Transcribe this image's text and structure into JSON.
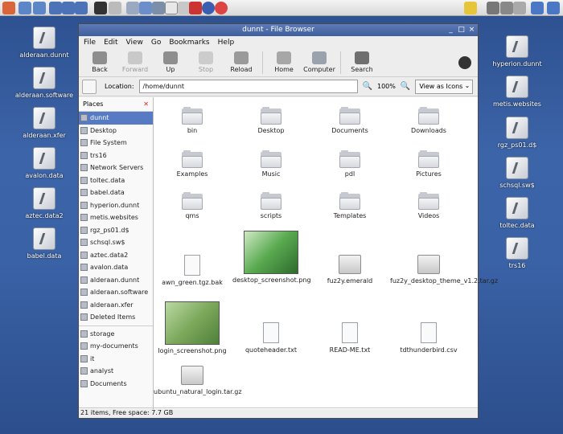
{
  "window": {
    "title": "dunnt - File Browser"
  },
  "menubar": [
    "File",
    "Edit",
    "View",
    "Go",
    "Bookmarks",
    "Help"
  ],
  "toolbar": {
    "back": "Back",
    "forward": "Forward",
    "up": "Up",
    "stop": "Stop",
    "reload": "Reload",
    "home": "Home",
    "computer": "Computer",
    "search": "Search"
  },
  "location": {
    "label": "Location:",
    "value": "/home/dunnt",
    "zoom": "100%",
    "view": "View as Icons"
  },
  "sidebar": {
    "header": "Places",
    "items": [
      "dunnt",
      "Desktop",
      "File System",
      "trs16",
      "Network Servers",
      "toltec.data",
      "babel.data",
      "hyperion.dunnt",
      "metis.websites",
      "rgz_ps01.d$",
      "schsql.sw$",
      "aztec.data2",
      "avalon.data",
      "alderaan.dunnt",
      "alderaan.software",
      "alderaan.xfer",
      "Deleted Items"
    ],
    "items2": [
      "storage",
      "my-documents",
      "it",
      "analyst",
      "Documents"
    ]
  },
  "files": [
    "bin",
    "Desktop",
    "Documents",
    "Downloads",
    "Examples",
    "Music",
    "pdl",
    "Pictures",
    "qms",
    "scripts",
    "Templates",
    "Videos",
    "awn_green.tgz.bak",
    "desktop_screenshot.png",
    "fuz2y.emerald",
    "fuz2y_desktop_theme_v1.2.tar.gz",
    "login_screenshot.png",
    "quoteheader.txt",
    "READ-ME.txt",
    "tdthunderbird.csv",
    "ubuntu_natural_login.tar.gz"
  ],
  "status": "21 items, Free space: 7.7 GB",
  "desktop_left": [
    "alderaan.dunnt",
    "alderaan.software",
    "alderaan.xfer",
    "avalon.data",
    "aztec.data2",
    "babel.data"
  ],
  "desktop_right": [
    "hyperion.dunnt",
    "metis.websites",
    "rgz_ps01.d$",
    "schsql.sw$",
    "toltec.data",
    "trs16"
  ]
}
